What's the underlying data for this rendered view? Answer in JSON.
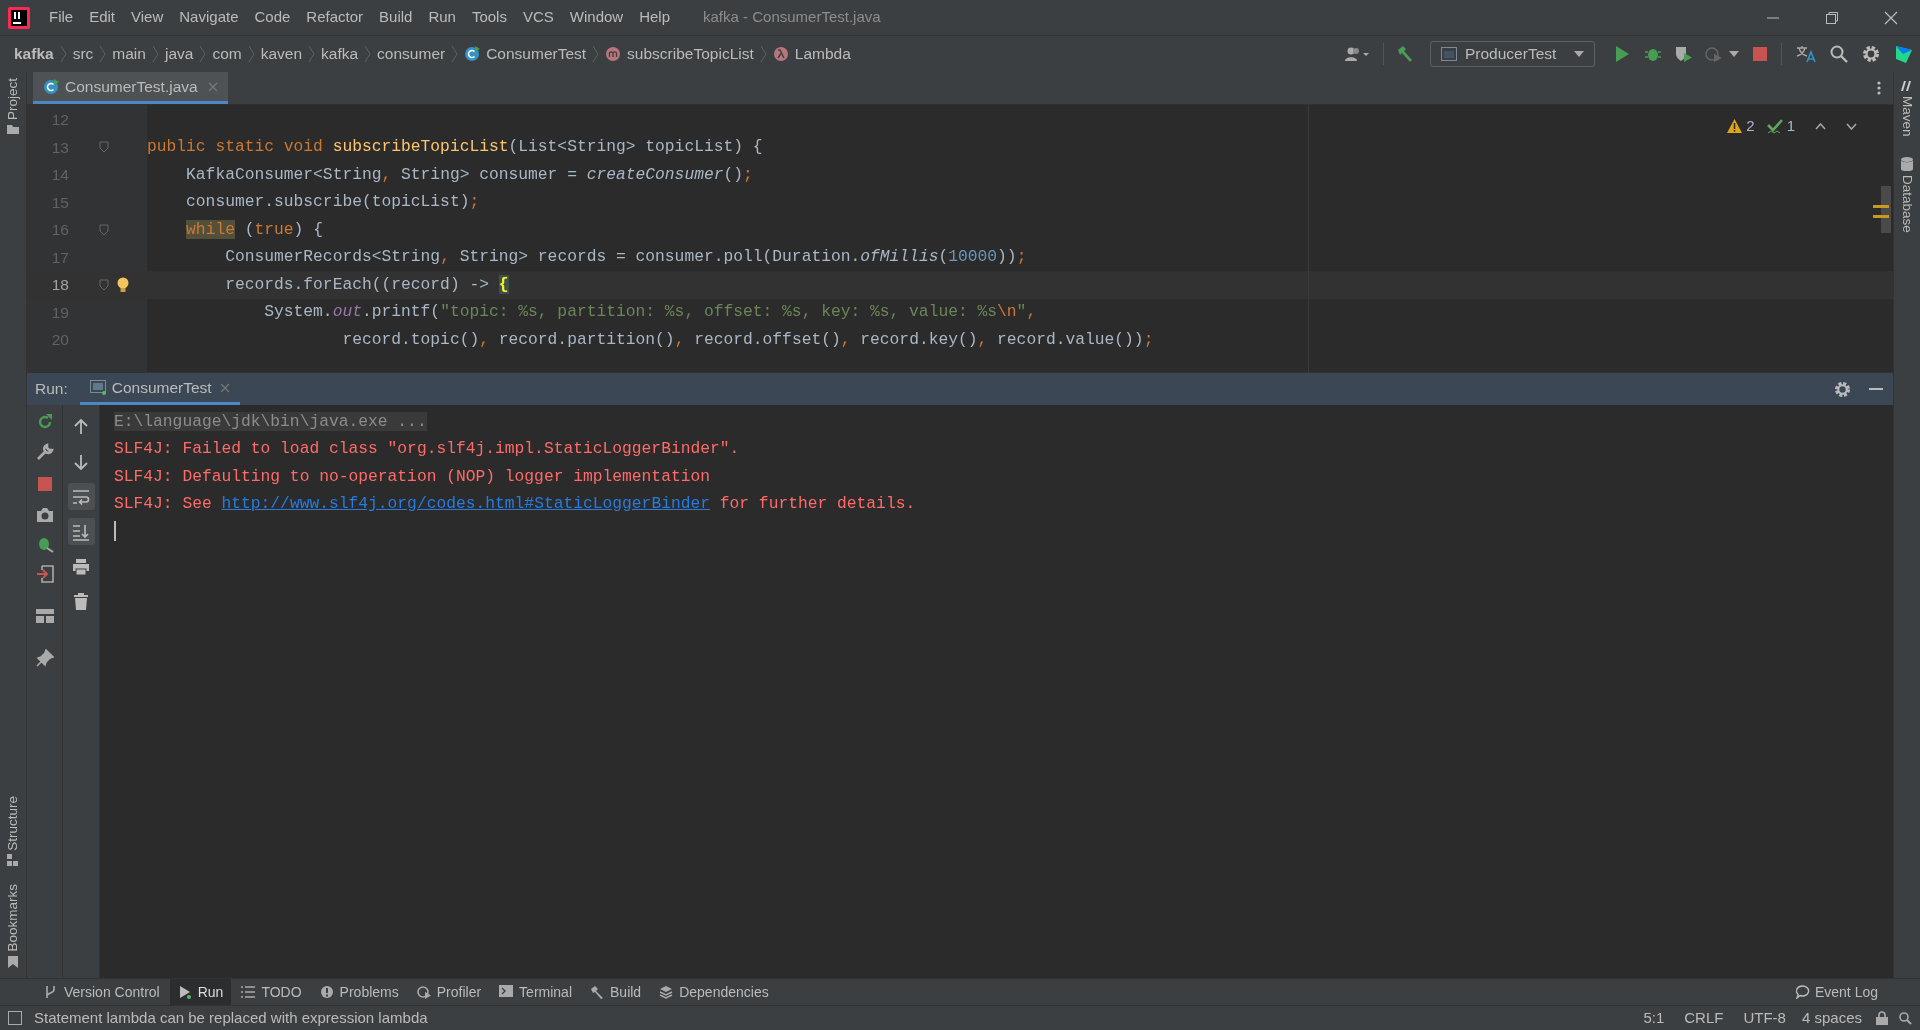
{
  "window": {
    "title": "kafka - ConsumerTest.java"
  },
  "menu": [
    "File",
    "Edit",
    "View",
    "Navigate",
    "Code",
    "Refactor",
    "Build",
    "Run",
    "Tools",
    "VCS",
    "Window",
    "Help"
  ],
  "breadcrumbs": [
    {
      "label": "kafka",
      "kind": "project"
    },
    {
      "label": "src",
      "kind": "folder"
    },
    {
      "label": "main",
      "kind": "folder"
    },
    {
      "label": "java",
      "kind": "folder"
    },
    {
      "label": "com",
      "kind": "folder"
    },
    {
      "label": "kaven",
      "kind": "folder"
    },
    {
      "label": "kafka",
      "kind": "folder"
    },
    {
      "label": "consumer",
      "kind": "folder"
    },
    {
      "label": "ConsumerTest",
      "kind": "class"
    },
    {
      "label": "subscribeTopicList",
      "kind": "method"
    },
    {
      "label": "Lambda",
      "kind": "lambda"
    }
  ],
  "run_config": "ProducerTest",
  "editor_tabs": [
    {
      "label": "ConsumerTest.java",
      "selected": true
    }
  ],
  "inspections": {
    "warnings": "2",
    "weak_warnings": "1"
  },
  "code_lines": [
    {
      "number": "12",
      "current": false,
      "fold": false,
      "bulb": false
    },
    {
      "number": "13",
      "current": false,
      "fold": true,
      "bulb": false,
      "tokens": [
        {
          "text": "public static void ",
          "kind": "keyword"
        },
        {
          "text": "subscribeTopicList",
          "kind": "method_decl"
        },
        {
          "text": "(List<String> topicList) {",
          "kind": "plain"
        }
      ]
    },
    {
      "number": "14",
      "current": false,
      "fold": false,
      "bulb": false,
      "tokens": [
        {
          "text": "    KafkaConsumer<String",
          "kind": "plain"
        },
        {
          "text": ", ",
          "kind": "keyword"
        },
        {
          "text": "String> consumer = ",
          "kind": "plain"
        },
        {
          "text": "createConsumer",
          "kind": "italic"
        },
        {
          "text": "()",
          "kind": "plain"
        },
        {
          "text": ";",
          "kind": "keyword"
        }
      ]
    },
    {
      "number": "15",
      "current": false,
      "fold": false,
      "bulb": false,
      "tokens": [
        {
          "text": "    consumer.subscribe(topicList)",
          "kind": "plain"
        },
        {
          "text": ";",
          "kind": "keyword"
        }
      ]
    },
    {
      "number": "16",
      "current": false,
      "fold": true,
      "bulb": false,
      "tokens": [
        {
          "text": "    while",
          "kind": "marked"
        },
        {
          "text": " (",
          "kind": "plain"
        },
        {
          "text": "true",
          "kind": "keyword"
        },
        {
          "text": ") {",
          "kind": "plain"
        }
      ]
    },
    {
      "number": "17",
      "current": false,
      "fold": false,
      "bulb": false,
      "tokens": [
        {
          "text": "        ConsumerRecords<String",
          "kind": "plain"
        },
        {
          "text": ", ",
          "kind": "keyword"
        },
        {
          "text": "String> records = consumer.poll(Duration.",
          "kind": "plain"
        },
        {
          "text": "ofMillis",
          "kind": "italic"
        },
        {
          "text": "(",
          "kind": "plain"
        },
        {
          "text": "10000",
          "kind": "number"
        },
        {
          "text": "))",
          "kind": "plain"
        },
        {
          "text": ";",
          "kind": "keyword"
        }
      ]
    },
    {
      "number": "18",
      "current": true,
      "fold": true,
      "bulb": true,
      "tokens": [
        {
          "text": "        records.forEach((record) -> ",
          "kind": "plain"
        },
        {
          "text": "{",
          "kind": "brace"
        }
      ]
    },
    {
      "number": "19",
      "current": false,
      "fold": false,
      "bulb": false,
      "tokens": [
        {
          "text": "            System.",
          "kind": "plain"
        },
        {
          "text": "out",
          "kind": "field"
        },
        {
          "text": ".printf(",
          "kind": "plain"
        },
        {
          "text": "\"topic: %s, partition: %s, offset: %s, key: %s, value: %s",
          "kind": "string"
        },
        {
          "text": "\\n",
          "kind": "escape"
        },
        {
          "text": "\"",
          "kind": "string"
        },
        {
          "text": ",",
          "kind": "keyword"
        }
      ]
    },
    {
      "number": "20",
      "current": false,
      "fold": false,
      "bulb": false,
      "tokens": [
        {
          "text": "                    record.topic()",
          "kind": "plain"
        },
        {
          "text": ", ",
          "kind": "keyword"
        },
        {
          "text": "record.partition()",
          "kind": "plain"
        },
        {
          "text": ", ",
          "kind": "keyword"
        },
        {
          "text": "record.offset()",
          "kind": "plain"
        },
        {
          "text": ", ",
          "kind": "keyword"
        },
        {
          "text": "record.key()",
          "kind": "plain"
        },
        {
          "text": ", ",
          "kind": "keyword"
        },
        {
          "text": "record.value())",
          "kind": "plain"
        },
        {
          "text": ";",
          "kind": "keyword"
        }
      ]
    }
  ],
  "run_panel": {
    "label": "Run:",
    "tabs": [
      {
        "label": "ConsumerTest",
        "selected": true
      }
    ],
    "toolbar": [
      {
        "kind": "up",
        "on": false
      },
      {
        "kind": "down",
        "on": false
      },
      {
        "kind": "wrap",
        "on": true
      },
      {
        "kind": "scroll_end",
        "on": true
      },
      {
        "kind": "print",
        "on": false
      },
      {
        "kind": "trash",
        "on": false
      }
    ],
    "console": [
      {
        "parts": [
          {
            "text": "E:\\language\\jdk\\bin\\java.exe ...",
            "kind": "command"
          }
        ]
      },
      {
        "parts": [
          {
            "text": "SLF4J: Failed to load class \"org.slf4j.impl.StaticLoggerBinder\".",
            "kind": "error"
          }
        ]
      },
      {
        "parts": [
          {
            "text": "SLF4J: Defaulting to no-operation (NOP) logger implementation",
            "kind": "error"
          }
        ]
      },
      {
        "parts": [
          {
            "text": "SLF4J: See ",
            "kind": "error"
          },
          {
            "text": "http://www.slf4j.org/codes.html#StaticLoggerBinder",
            "kind": "link"
          },
          {
            "text": " for further details.",
            "kind": "error"
          }
        ]
      }
    ]
  },
  "left_strip": {
    "top": [
      "Project"
    ],
    "bottom": [
      "Structure",
      "Bookmarks"
    ]
  },
  "right_strip": [
    "Maven",
    "Database"
  ],
  "bottom_bar": [
    {
      "label": "Version Control",
      "kind": "vcs",
      "selected": false
    },
    {
      "label": "Run",
      "kind": "run",
      "selected": true
    },
    {
      "label": "TODO",
      "kind": "todo",
      "selected": false
    },
    {
      "label": "Problems",
      "kind": "problems",
      "selected": false
    },
    {
      "label": "Profiler",
      "kind": "profiler",
      "selected": false
    },
    {
      "label": "Terminal",
      "kind": "terminal",
      "selected": false
    },
    {
      "label": "Build",
      "kind": "build",
      "selected": false
    },
    {
      "label": "Dependencies",
      "kind": "deps",
      "selected": false
    }
  ],
  "event_log": "Event Log",
  "status_bar": {
    "message": "Statement lambda can be replaced with expression lambda",
    "position": "5:1",
    "line_separator": "CRLF",
    "encoding": "UTF-8",
    "indent": "4 spaces"
  }
}
